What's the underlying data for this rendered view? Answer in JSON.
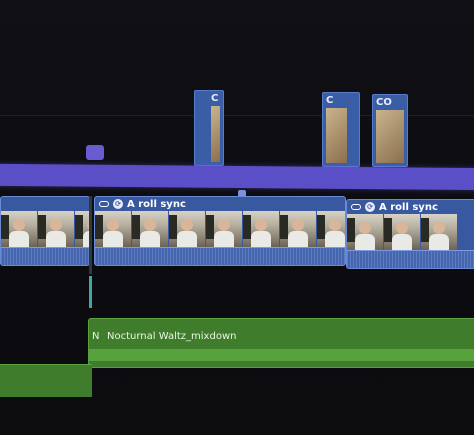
{
  "timeline": {
    "connected_clips": [
      {
        "label": "C"
      },
      {
        "label": "C"
      },
      {
        "label": "CO"
      }
    ],
    "primary_clips": [
      {
        "label": "A roll sync"
      },
      {
        "label": "A roll sync"
      }
    ],
    "audio_clip": {
      "marker": "N",
      "label": "Nocturnal Waltz_mixdown"
    }
  }
}
